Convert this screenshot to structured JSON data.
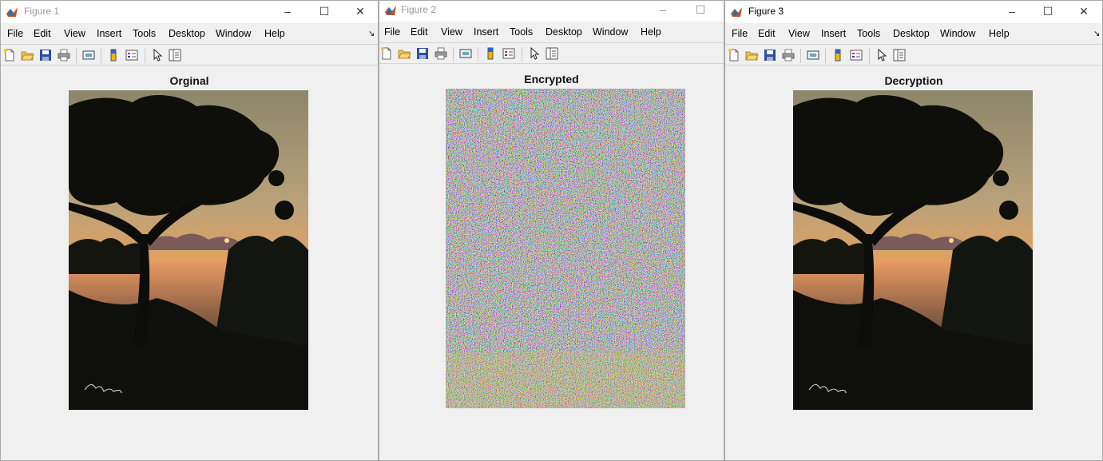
{
  "windows": [
    {
      "title": "Figure 1",
      "menus": [
        "File",
        "Edit",
        "View",
        "Insert",
        "Tools",
        "Desktop",
        "Window",
        "Help"
      ],
      "axes_title": "Orginal",
      "image_kind": "sunset-photo"
    },
    {
      "title": "Figure 2",
      "menus": [
        "File",
        "Edit",
        "View",
        "Insert",
        "Tools",
        "Desktop",
        "Window",
        "Help"
      ],
      "axes_title": "Encrypted",
      "image_kind": "noise"
    },
    {
      "title": "Figure 3",
      "menus": [
        "File",
        "Edit",
        "View",
        "Insert",
        "Tools",
        "Desktop",
        "Window",
        "Help"
      ],
      "axes_title": "Decryption",
      "image_kind": "sunset-photo"
    }
  ],
  "toolbar_icons": [
    "new-figure-icon",
    "open-file-icon",
    "save-figure-icon",
    "print-figure-icon",
    "link-plot-icon",
    "insert-colorbar-icon",
    "insert-legend-icon",
    "edit-plot-icon",
    "property-inspector-icon"
  ],
  "window_controls": {
    "minimize": "–",
    "maximize": "☐",
    "close": "✕"
  },
  "colors": {
    "frame_bg": "#f0f0f0",
    "sky_top": "#a89a6e",
    "sky_glow": "#f2a35a",
    "water": "#e59a60"
  }
}
